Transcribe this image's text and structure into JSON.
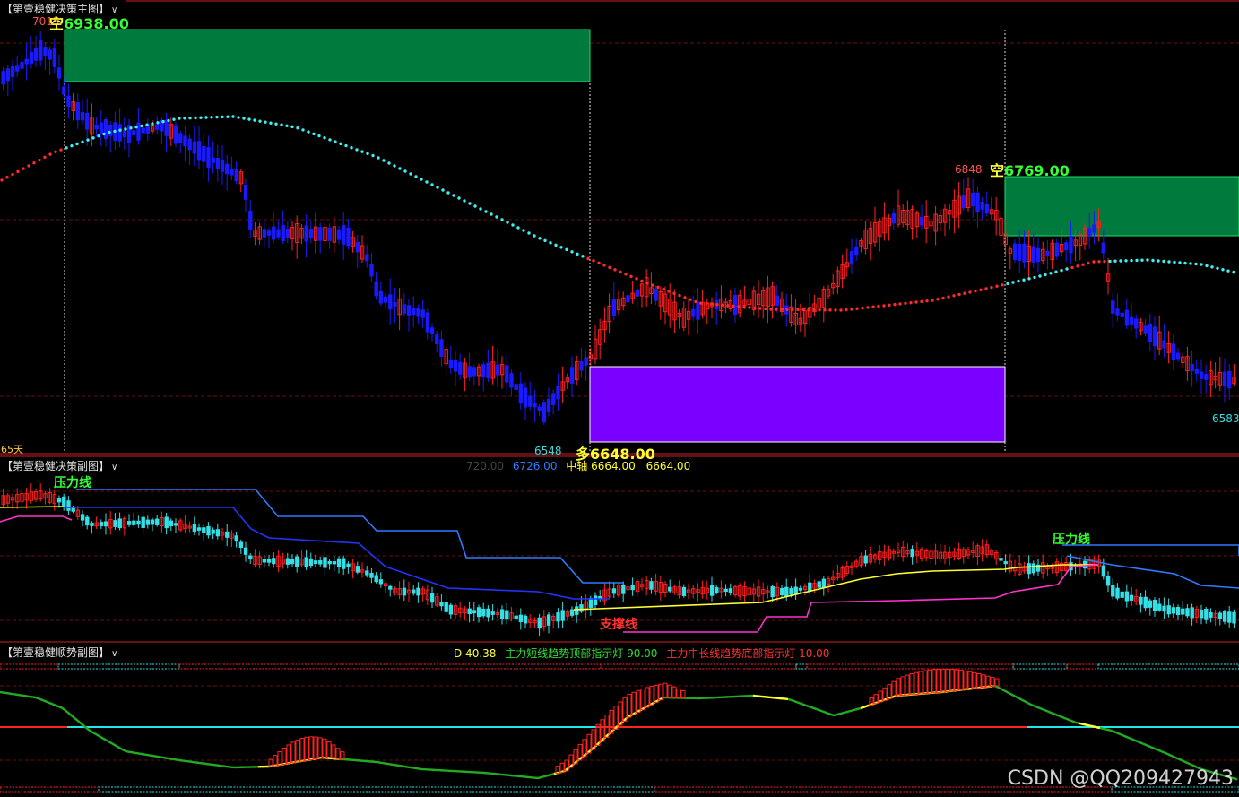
{
  "panels": {
    "main": {
      "title": "【第壹稳健决策主图】",
      "dropdown_glyph": "∨"
    },
    "sub1": {
      "title": "【第壹稳健决策副图】",
      "dropdown_glyph": "∨"
    },
    "sub2": {
      "title": "【第壹稳健顺势副图】",
      "dropdown_glyph": "∨"
    }
  },
  "main_labels": {
    "top_left_price": "7015",
    "short1_char": "空",
    "short1_price": "6938.00",
    "short2_char": "空",
    "short2_price": "6769.00",
    "long_char": "多",
    "long_price": "6648.00",
    "high_label": "6848",
    "low_label": "6548",
    "right_low_label": "6583",
    "days_label": "65天"
  },
  "sub1_readout": {
    "faded": "720.00",
    "upper": "6726.00",
    "mid_label": "中轴",
    "mid": "6664.00",
    "lower": "6664.00"
  },
  "sub1_labels": {
    "resistance_left": "压力线",
    "resistance_right": "压力线",
    "support": "支撑线"
  },
  "sub2_readout": {
    "d": "D 40.38",
    "top": "主力短线趋势顶部指示灯 90.00",
    "bottom": "主力中长线趋势底部指示灯 10.00"
  },
  "watermark": "CSDN @QQ209427943",
  "colors": {
    "up": "#ff2020",
    "down": "#1a1aff",
    "sub_down": "#33e0e8",
    "green_zone": "#007a3d",
    "purple_zone": "#7a00ff",
    "cyan_dots": "#3ef0f0",
    "red_dots": "#ff2a2a",
    "upper_band": "#2f7bff",
    "mid_band": "#2233ff",
    "yellow_line": "#ffff33",
    "magenta_line": "#ff33cc",
    "osc_green": "#22aa22",
    "osc_yellow": "#ffff33",
    "cyan_line": "#22e6e6"
  },
  "chart_data": [
    {
      "type": "candlestick",
      "panel": "main",
      "ylim": [
        6548,
        7015
      ],
      "annotations": [
        "空 6938.00",
        "空 6769.00",
        "多 6648.00",
        "6848",
        "6548",
        "6583",
        "7015"
      ]
    },
    {
      "type": "candlestick-with-bands",
      "panel": "sub1",
      "legend": [
        "720.00",
        "6726.00",
        "中轴 6664.00",
        "6664.00"
      ]
    },
    {
      "type": "line",
      "panel": "sub2",
      "legend": [
        "D 40.38",
        "主力短线趋势顶部指示灯 90.00",
        "主力中长线趋势底部指示灯 10.00"
      ]
    }
  ]
}
